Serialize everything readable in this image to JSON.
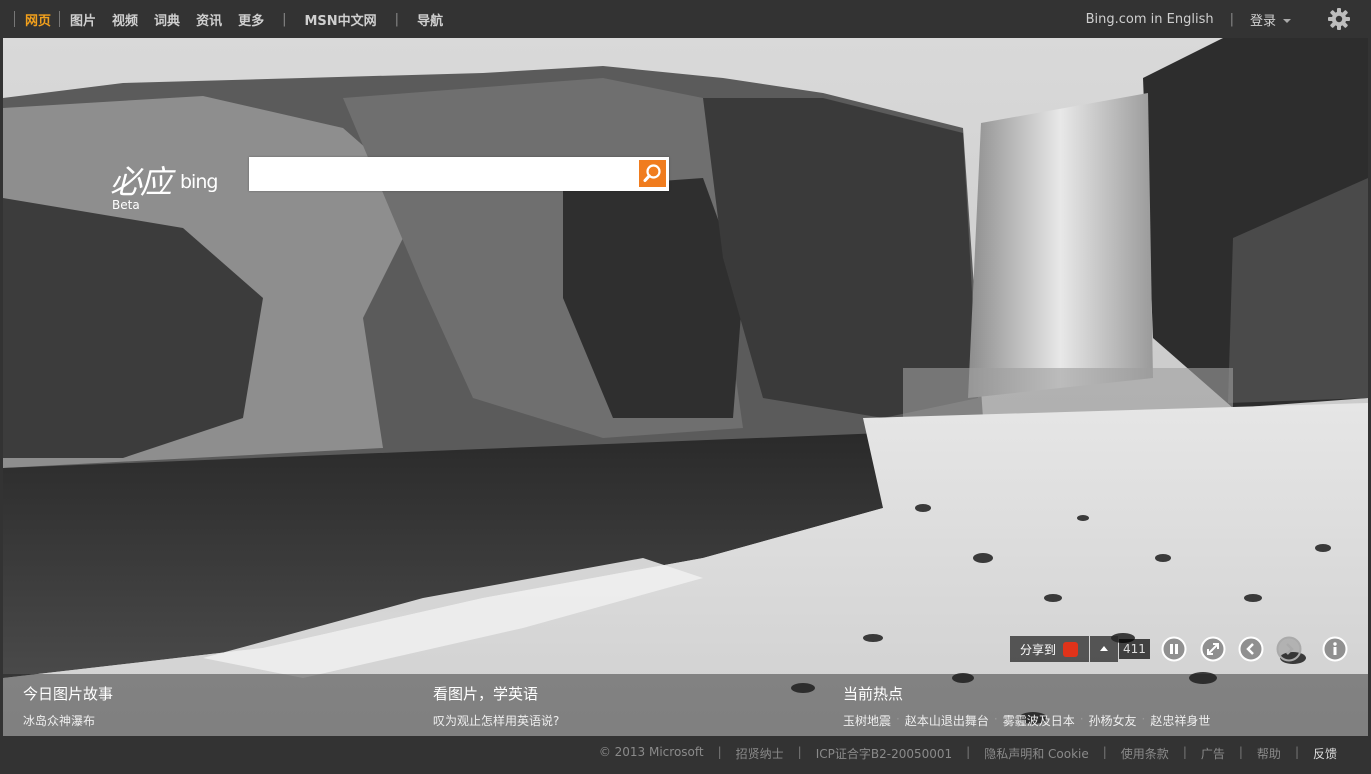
{
  "topnav": {
    "items": [
      "网页",
      "图片",
      "视频",
      "词典",
      "资讯",
      "更多"
    ],
    "msn": "MSN中文网",
    "nav": "导航",
    "english": "Bing.com in English",
    "login": "登录"
  },
  "logo": {
    "cn": "必应",
    "en": "bing",
    "beta": "Beta"
  },
  "search": {
    "value": "",
    "placeholder": ""
  },
  "controls": {
    "share_label": "分享到",
    "count": "411"
  },
  "strip": {
    "story_title": "今日图片故事",
    "story_sub": "冰岛众神瀑布",
    "english_title": "看图片，学英语",
    "english_sub": "叹为观止怎样用英语说?",
    "hot_title": "当前热点",
    "hot_items": [
      "玉树地震",
      "赵本山退出舞台",
      "雾霾波及日本",
      "孙杨女友",
      "赵忠祥身世"
    ]
  },
  "footer": {
    "items": [
      "© 2013 Microsoft",
      "招贤纳士",
      "ICP证合字B2-20050001",
      "隐私声明和 Cookie",
      "使用条款",
      "广告",
      "帮助",
      "反馈"
    ]
  },
  "colors": {
    "accent": "#f2a01c",
    "search_button": "#f07c1e",
    "bar": "#333333"
  },
  "icons": [
    "search-icon",
    "gear-icon",
    "weibo-icon",
    "pause-icon",
    "fullscreen-icon",
    "prev-icon",
    "next-icon",
    "info-icon"
  ]
}
